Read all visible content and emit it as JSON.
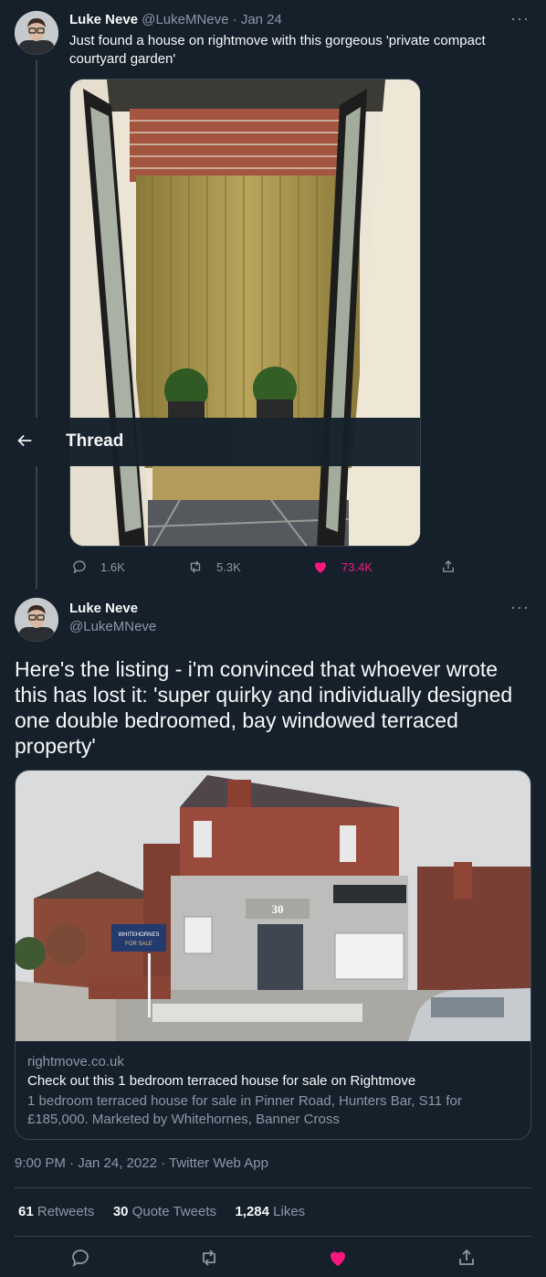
{
  "tweet1": {
    "name": "Luke Neve",
    "handle": "@LukeMNeve",
    "date": "· Jan 24",
    "text": "Just found a house on rightmove with this gorgeous 'private compact courtyard garden'",
    "replies": "1.6K",
    "retweets": "5.3K",
    "likes": "73.4K"
  },
  "nav": {
    "title": "Thread"
  },
  "tweet2": {
    "name": "Luke Neve",
    "handle": "@LukeMNeve",
    "text": "Here's the listing - i'm convinced that whoever wrote this has lost it: 'super quirky and individually designed one double bedroomed, bay windowed terraced property'",
    "card": {
      "domain": "rightmove.co.uk",
      "title": "Check out this 1 bedroom terraced house for sale on Rightmove",
      "description": "1 bedroom terraced house for sale in Pinner Road, Hunters Bar, S11 for £185,000. Marketed by Whitehornes, Banner Cross",
      "door_number": "30",
      "agent_board_top": "WHITEHORNES",
      "agent_board_bottom": "FOR SALE"
    },
    "timestamp": "9:00 PM · Jan 24, 2022 · Twitter Web App",
    "stats": {
      "retweets_count": "61",
      "retweets_label": "Retweets",
      "quotes_count": "30",
      "quotes_label": "Quote Tweets",
      "likes_count": "1,284",
      "likes_label": "Likes"
    }
  },
  "colors": {
    "background": "#15202b",
    "like": "#f91880",
    "muted": "#8b98a5",
    "border": "#38444d"
  }
}
